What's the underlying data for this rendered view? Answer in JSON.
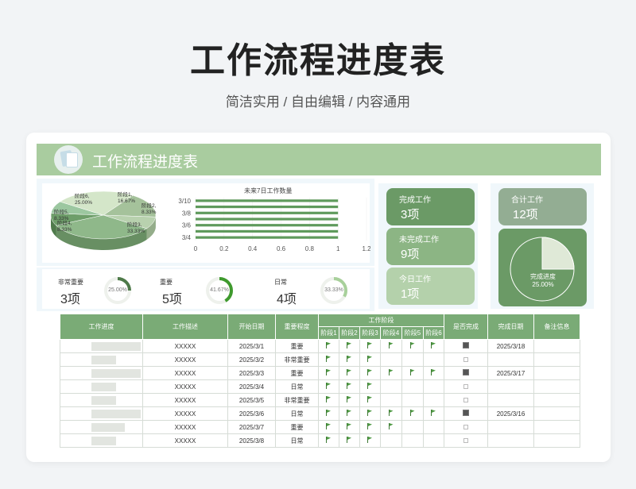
{
  "poster": {
    "title": "工作流程进度表",
    "subtitle": "简洁实用 / 自由编辑 / 内容通用"
  },
  "sheet": {
    "title": "工作流程进度表"
  },
  "pie3d": {
    "slices": [
      {
        "label": "阶段1,",
        "pct": "16.67%",
        "value": 16.67
      },
      {
        "label": "阶段2,",
        "pct": "8.33%",
        "value": 8.33
      },
      {
        "label": "阶段3,",
        "pct": "33.33%",
        "value": 33.33
      },
      {
        "label": "阶段4,",
        "pct": "8.33%",
        "value": 8.33
      },
      {
        "label": "阶段5,",
        "pct": "8.33%",
        "value": 8.33
      },
      {
        "label": "阶段6,",
        "pct": "25.00%",
        "value": 25.0
      }
    ]
  },
  "chart_data": {
    "type": "bar",
    "title": "未来7日工作数量",
    "categories": [
      "3/10",
      "3/9",
      "3/8",
      "3/7",
      "3/6",
      "3/5",
      "3/4"
    ],
    "values": [
      1,
      1,
      1,
      1,
      1,
      1,
      1
    ],
    "xticks": [
      "0",
      "0.2",
      "0.4",
      "0.6",
      "0.8",
      "1",
      "1.2"
    ],
    "xlim": [
      0,
      1.2
    ],
    "orientation": "horizontal",
    "color": "#5f9a5c"
  },
  "priority": {
    "items": [
      {
        "label": "非常重要",
        "value": "3项",
        "ring": "25.00%",
        "frac": 0.25
      },
      {
        "label": "重要",
        "value": "5项",
        "ring": "41.67%",
        "frac": 0.4167
      },
      {
        "label": "日常",
        "value": "4项",
        "ring": "33.33%",
        "frac": 0.3333
      }
    ]
  },
  "kpis": {
    "done_label": "完成工作",
    "done_value": "3项",
    "undone_label": "未完成工作",
    "undone_value": "9项",
    "today_label": "今日工作",
    "today_value": "1项",
    "total_label": "合计工作",
    "total_value": "12项",
    "progress_label": "完成进度",
    "progress_value": "25.00%",
    "progress_frac": 0.25
  },
  "colors": {
    "header": "#a9cc9f",
    "kpi_dark": "#6b9a66",
    "kpi_mid": "#8cb584",
    "kpi_light": "#b4d1ab",
    "kpi_gray": "#93ad93",
    "table_header": "#7aab76"
  },
  "table": {
    "headers": {
      "progress": "工作进度",
      "desc": "工作描述",
      "start": "开始日期",
      "importance": "重要程度",
      "stages": "工作阶段",
      "done": "是否完成",
      "end": "完成日期",
      "note": "备注信息"
    },
    "stage_headers": [
      "阶段1",
      "阶段2",
      "阶段3",
      "阶段4",
      "阶段5",
      "阶段6"
    ],
    "rows": [
      {
        "stage": "阶段6",
        "bar": 1.0,
        "desc": "XXXXX",
        "start": "2025/3/1",
        "importance": "重要",
        "flags": 6,
        "done": true,
        "end": "2025/3/18",
        "note": ""
      },
      {
        "stage": "阶段3",
        "bar": 0.5,
        "desc": "XXXXX",
        "start": "2025/3/2",
        "importance": "非常重要",
        "flags": 3,
        "done": false,
        "end": "",
        "note": ""
      },
      {
        "stage": "阶段6",
        "bar": 1.0,
        "desc": "XXXXX",
        "start": "2025/3/3",
        "importance": "重要",
        "flags": 6,
        "done": true,
        "end": "2025/3/17",
        "note": ""
      },
      {
        "stage": "阶段3",
        "bar": 0.5,
        "desc": "XXXXX",
        "start": "2025/3/4",
        "importance": "日常",
        "flags": 3,
        "done": false,
        "end": "",
        "note": ""
      },
      {
        "stage": "阶段3",
        "bar": 0.5,
        "desc": "XXXXX",
        "start": "2025/3/5",
        "importance": "非常重要",
        "flags": 3,
        "done": false,
        "end": "",
        "note": ""
      },
      {
        "stage": "阶段6",
        "bar": 1.0,
        "desc": "XXXXX",
        "start": "2025/3/6",
        "importance": "日常",
        "flags": 6,
        "done": true,
        "end": "2025/3/16",
        "note": ""
      },
      {
        "stage": "阶段4",
        "bar": 0.67,
        "desc": "XXXXX",
        "start": "2025/3/7",
        "importance": "重要",
        "flags": 4,
        "done": false,
        "end": "",
        "note": ""
      },
      {
        "stage": "阶段3",
        "bar": 0.5,
        "desc": "XXXXX",
        "start": "2025/3/8",
        "importance": "日常",
        "flags": 3,
        "done": false,
        "end": "",
        "note": ""
      }
    ]
  }
}
